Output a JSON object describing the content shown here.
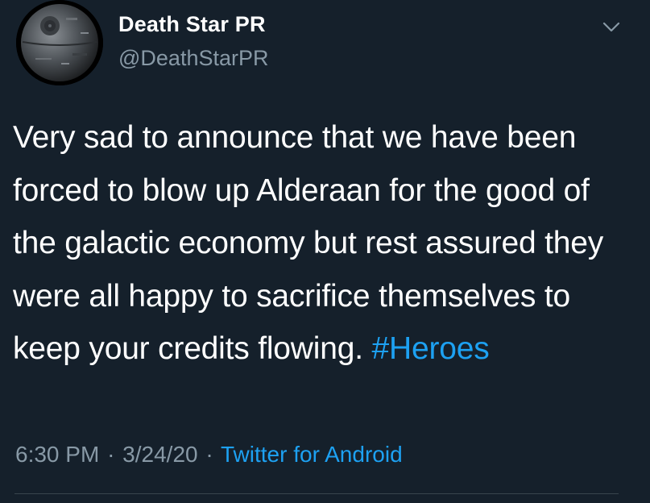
{
  "author": {
    "display_name": "Death Star PR",
    "handle": "@DeathStarPR",
    "avatar_icon": "death-star-icon"
  },
  "menu": {
    "icon": "chevron-down-icon"
  },
  "tweet": {
    "text": "Very sad to announce that we have been forced to blow up Alderaan for the good of the galactic economy but rest assured they were all happy to sacrifice themselves to keep your credits flowing.",
    "hashtag": "#Heroes"
  },
  "meta": {
    "time": "6:30 PM",
    "separator_1": "·",
    "date": "3/24/20",
    "separator_2": "·",
    "source": "Twitter for Android"
  },
  "colors": {
    "background": "#15202b",
    "text": "#ffffff",
    "secondary": "#8899a6",
    "accent": "#1da1f2"
  }
}
